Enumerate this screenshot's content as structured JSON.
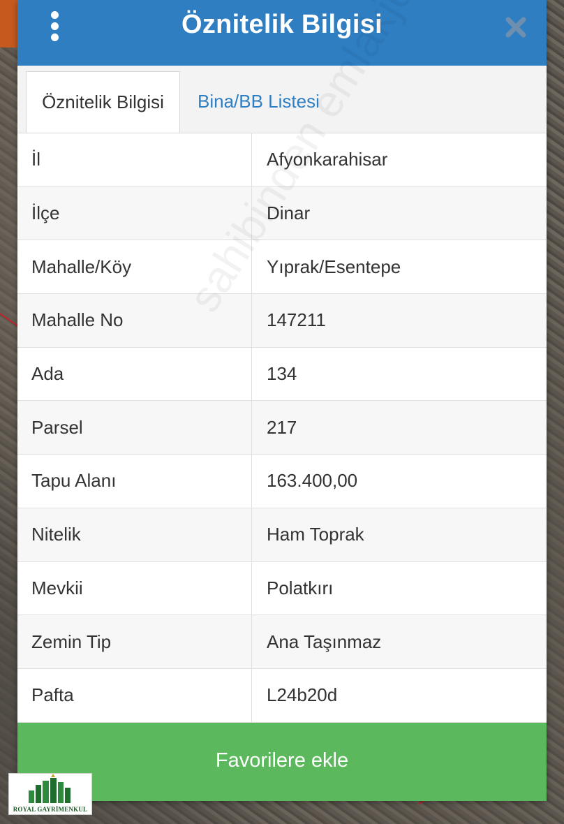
{
  "header": {
    "title": "Öznitelik Bilgisi"
  },
  "tabs": [
    {
      "label": "Öznitelik Bilgisi",
      "active": true
    },
    {
      "label": "Bina/BB Listesi",
      "active": false
    }
  ],
  "attributes": [
    {
      "key": "İl",
      "value": "Afyonkarahisar"
    },
    {
      "key": "İlçe",
      "value": "Dinar"
    },
    {
      "key": "Mahalle/Köy",
      "value": "Yıprak/Esentepe"
    },
    {
      "key": "Mahalle No",
      "value": "147211"
    },
    {
      "key": "Ada",
      "value": "134"
    },
    {
      "key": "Parsel",
      "value": "217"
    },
    {
      "key": "Tapu Alanı",
      "value": "163.400,00"
    },
    {
      "key": "Nitelik",
      "value": "Ham Toprak"
    },
    {
      "key": "Mevkii",
      "value": "Polatkırı"
    },
    {
      "key": "Zemin Tip",
      "value": "Ana Taşınmaz"
    },
    {
      "key": "Pafta",
      "value": "L24b20d"
    }
  ],
  "favorite_button": {
    "label": "Favorilere ekle"
  },
  "watermark": {
    "text": "sahibinden emlakjet.com"
  },
  "logo": {
    "text": "ROYAL GAYRİMENKUL"
  },
  "colors": {
    "header": "#2f7ec2",
    "button": "#5cb85c",
    "tab_link": "#2f7ec2"
  },
  "icons": {
    "menu": "kebab-menu-icon",
    "close": "close-icon"
  }
}
